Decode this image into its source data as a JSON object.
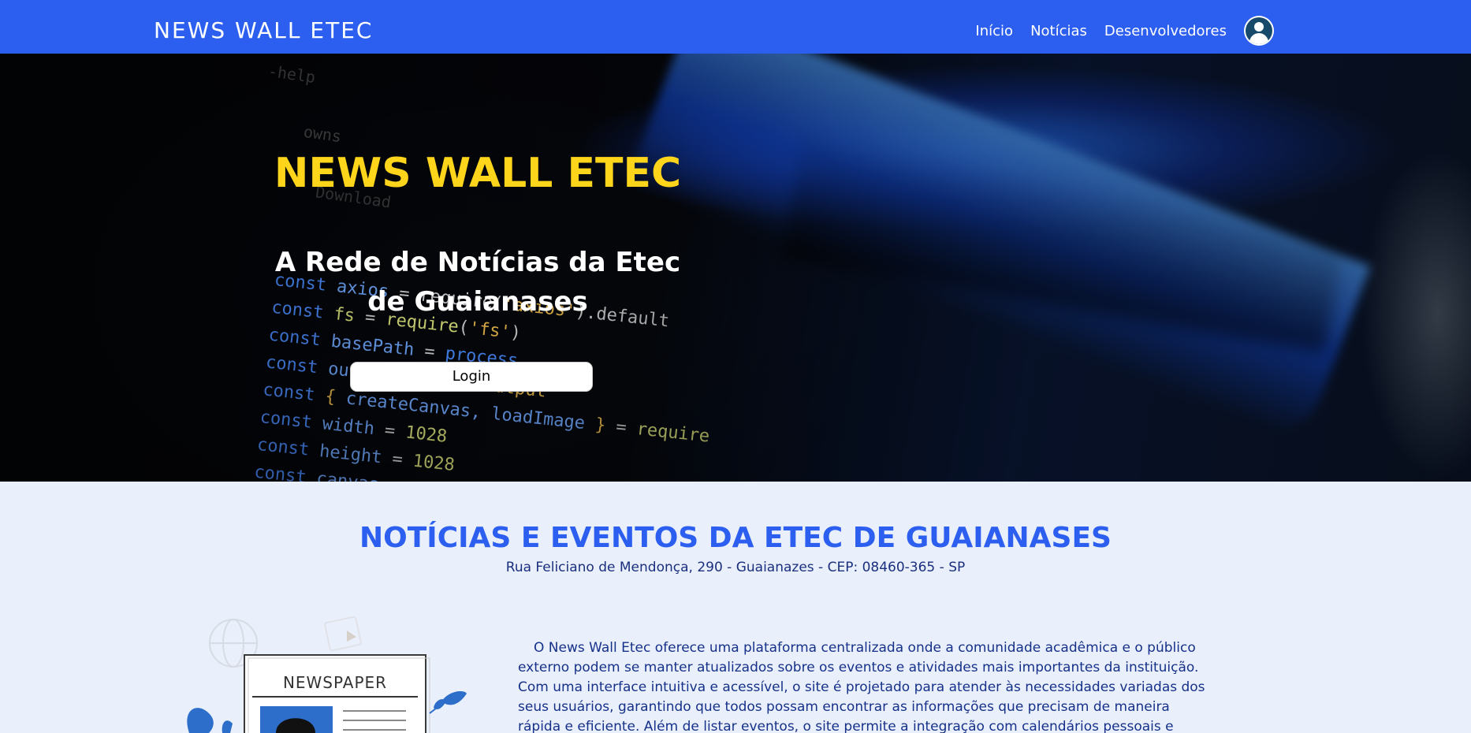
{
  "navbar": {
    "brand": "NEWS WALL ETEC",
    "links": [
      "Início",
      "Notícias",
      "Desenvolvedores"
    ],
    "avatar_icon": "user-avatar-icon",
    "bg_color": "#2c5ff0"
  },
  "hero": {
    "title": "NEWS WALL ETEC",
    "subtitle": "A Rede de Notícias da Etec de Guaianases",
    "login_label": "Login",
    "title_color": "#ffd51b"
  },
  "section": {
    "title": "NOTÍCIAS E EVENTOS DA ETEC DE GUAIANASES",
    "address": "Rua Feliciano de Mendonça, 290 - Guaianazes - CEP: 08460-365 - SP",
    "illustration_label": "NEWSPAPER",
    "paragraph": "O News Wall Etec oferece uma plataforma centralizada onde a comunidade acadêmica e o público externo podem se manter atualizados sobre os eventos e atividades mais importantes da instituição. Com uma interface intuitiva e acessível, o site é projetado para atender às necessidades variadas dos seus usuários, garantindo que todos possam encontrar as informações que precisam de maneira rápida e eficiente. Além de listar eventos, o site permite a integração com calendários pessoais e envia"
  }
}
